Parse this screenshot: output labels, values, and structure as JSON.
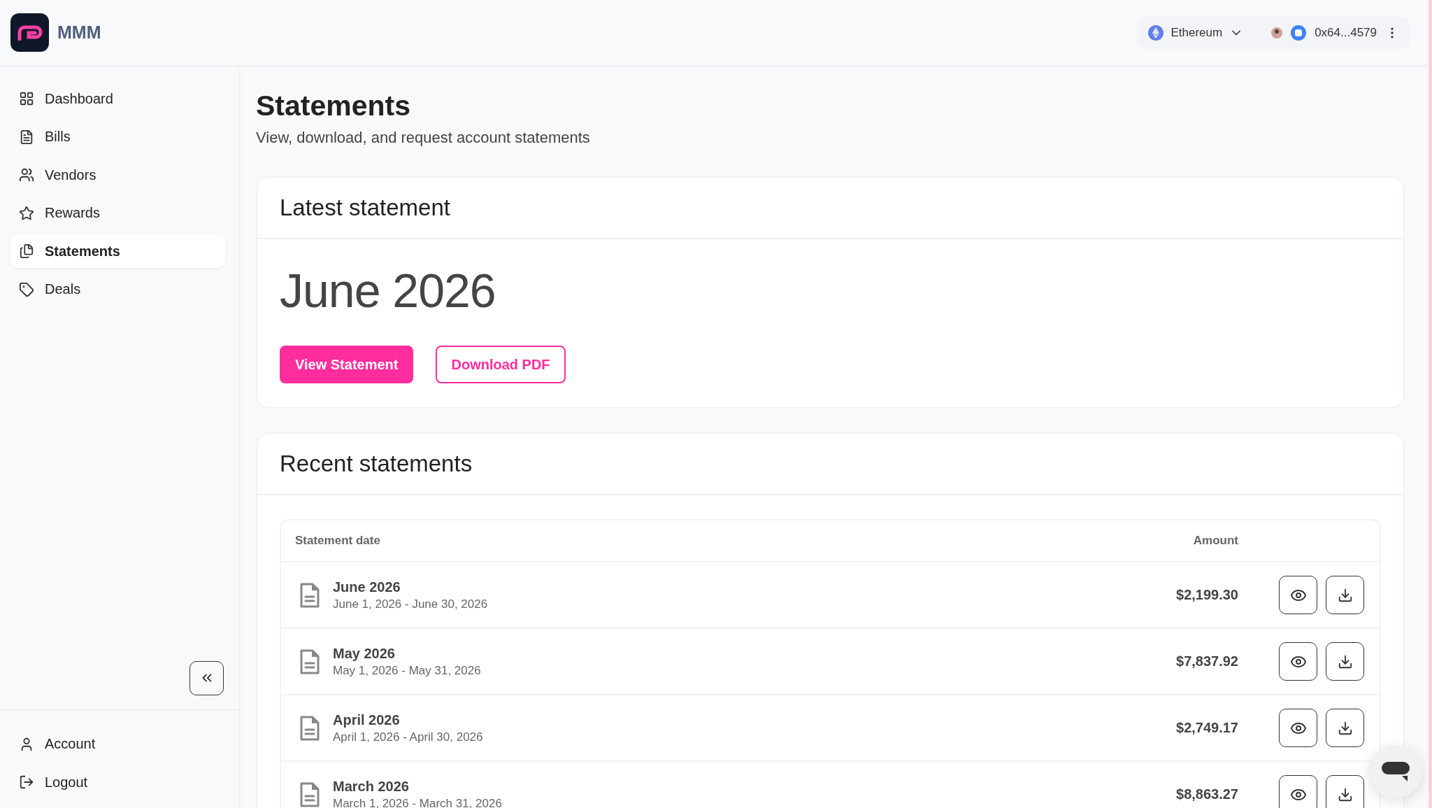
{
  "brand": {
    "name": "MMM"
  },
  "wallet": {
    "network": "Ethereum",
    "address": "0x64...4579"
  },
  "sidebar": {
    "items": [
      {
        "label": "Dashboard",
        "selected": false
      },
      {
        "label": "Bills",
        "selected": false
      },
      {
        "label": "Vendors",
        "selected": false
      },
      {
        "label": "Rewards",
        "selected": false
      },
      {
        "label": "Statements",
        "selected": true
      },
      {
        "label": "Deals",
        "selected": false
      }
    ],
    "footer_items": [
      {
        "label": "Account"
      },
      {
        "label": "Logout"
      }
    ]
  },
  "page": {
    "title": "Statements",
    "subtitle": "View, download, and request account statements"
  },
  "latest": {
    "heading": "Latest statement",
    "period": "June 2026",
    "buttons": [
      {
        "label": "View Statement",
        "kind": "primary"
      },
      {
        "label": "Download PDF",
        "kind": "outline"
      }
    ]
  },
  "recent": {
    "heading": "Recent statements",
    "columns": [
      "Statement date",
      "Amount"
    ],
    "rows": [
      {
        "title": "June 2026",
        "range": "June 1, 2026 - June 30, 2026",
        "amount": "$2,199.30"
      },
      {
        "title": "May 2026",
        "range": "May 1, 2026 - May 31, 2026",
        "amount": "$7,837.92"
      },
      {
        "title": "April 2026",
        "range": "April 1, 2026 - April 30, 2026",
        "amount": "$2,749.17"
      },
      {
        "title": "March 2026",
        "range": "March 1, 2026 - March 31, 2026",
        "amount": "$8,863.27"
      }
    ]
  }
}
